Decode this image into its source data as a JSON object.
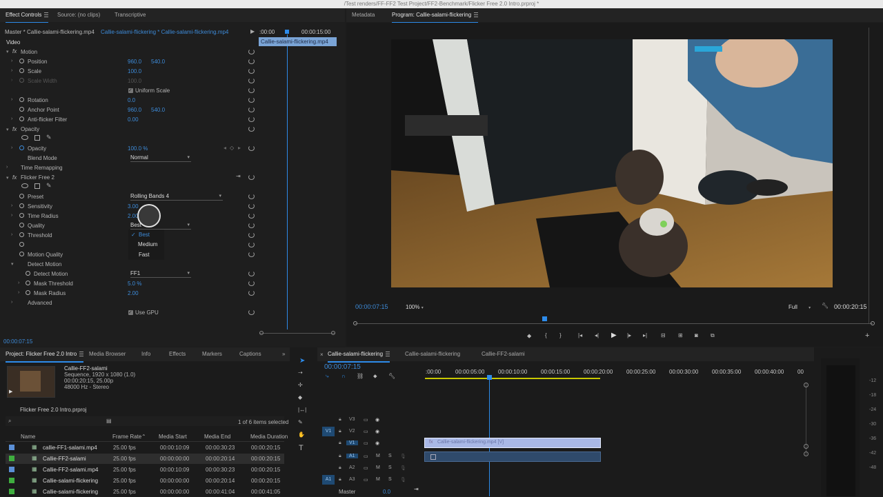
{
  "title_bar": "/Test renders/FF-FF2 Test Project/FF2-Benchmark/Flicker Free 2.0 Intro.prproj *",
  "top_tabs": {
    "effect_controls": "Effect Controls",
    "source": "Source: (no clips)",
    "transcriptive": "Transcriptive",
    "metadata": "Metadata",
    "program": "Program: Callie-salami-flickering"
  },
  "ec": {
    "master": "Master * Callie-salami-flickering.mp4",
    "clip": "Callie-salami-flickering * Callie-salami-flickering.mp4",
    "time_start": ":00:00",
    "time_end": "00:00:15:00",
    "clip_bar": "Callie-salami-flickering.mp4",
    "video_label": "Video",
    "current_time": "00:00:07:15",
    "motion": {
      "label": "Motion",
      "position": "Position",
      "pos_x": "960.0",
      "pos_y": "540.0",
      "scale": "Scale",
      "scale_val": "100.0",
      "scale_width": "Scale Width",
      "scale_width_val": "100.0",
      "uniform": "Uniform Scale",
      "rotation": "Rotation",
      "rotation_val": "0.0",
      "anchor": "Anchor Point",
      "anchor_x": "960.0",
      "anchor_y": "540.0",
      "antiflicker": "Anti-flicker Filter",
      "antiflicker_val": "0.00"
    },
    "opacity": {
      "label": "Opacity",
      "opacity": "Opacity",
      "opacity_val": "100.0 %",
      "blend": "Blend Mode",
      "blend_val": "Normal"
    },
    "time_remap": "Time Remapping",
    "ff": {
      "label": "Flicker Free 2",
      "preset": "Preset",
      "preset_val": "Rolling Bands 4",
      "sensitivity": "Sensitivity",
      "sensitivity_val": "3.00",
      "time_radius": "Time Radius",
      "time_radius_val": "2.00",
      "quality": "Quality",
      "quality_val": "Best",
      "threshold": "Threshold",
      "motion_quality": "Motion Quality",
      "detect_motion_group": "Detect Motion",
      "detect_motion": "Detect Motion",
      "detect_motion_val": "FF1",
      "mask_threshold": "Mask Threshold",
      "mask_threshold_val": "5.0 %",
      "mask_radius": "Mask Radius",
      "mask_radius_val": "2.00",
      "advanced": "Advanced",
      "use_gpu": "Use GPU"
    },
    "quality_menu": [
      "Best",
      "Medium",
      "Fast"
    ]
  },
  "program": {
    "timecode": "00:00:07:15",
    "zoom": "100%",
    "quality": "Full",
    "duration": "00:00:20:15"
  },
  "project": {
    "tabs": [
      "Project: Flicker Free 2.0 Intro",
      "Media Browser",
      "Info",
      "Effects",
      "Markers",
      "Captions"
    ],
    "item_name": "Callie-FF2-salami",
    "item_line1": "Sequence, 1920 x 1080 (1.0)",
    "item_line2": "00:00:20:15, 25.00p",
    "item_line3": "48000 Hz - Stereo",
    "project_file": "Flicker Free 2.0 Intro.prproj",
    "selected": "1 of 6 items selected",
    "columns": [
      "Name",
      "Frame Rate",
      "Media Start",
      "Media End",
      "Media Duration"
    ],
    "rows": [
      {
        "name": "callie-FF1-salami.mp4",
        "fps": "25.00 fps",
        "start": "00:00:10:09",
        "end": "00:00:30:23",
        "dur": "00:00:20:15",
        "color": "#5b8fd6"
      },
      {
        "name": "Callie-FF2-salami",
        "fps": "25.00 fps",
        "start": "00:00:00:00",
        "end": "00:00:20:14",
        "dur": "00:00:20:15",
        "color": "#3fae3f"
      },
      {
        "name": "Callie-FF2-salami.mp4",
        "fps": "25.00 fps",
        "start": "00:00:10:09",
        "end": "00:00:30:23",
        "dur": "00:00:20:15",
        "color": "#5b8fd6"
      },
      {
        "name": "Callie-salami-flickering",
        "fps": "25.00 fps",
        "start": "00:00:00:00",
        "end": "00:00:20:14",
        "dur": "00:00:20:15",
        "color": "#3fae3f"
      },
      {
        "name": "Callie-salami-flickering",
        "fps": "25.00 fps",
        "start": "00:00:00:00",
        "end": "00:00:41:04",
        "dur": "00:00:41:05",
        "color": "#3fae3f"
      }
    ]
  },
  "timeline": {
    "tabs": [
      "Callie-salami-flickering",
      "Callie-salami-flickering",
      "Callie-FF2-salami"
    ],
    "timecode": "00:00:07:15",
    "ruler": ":00:00",
    "r1": "00:00:05:00",
    "r2": "00:00:10:00",
    "r3": "00:00:15:00",
    "r4": "00:00:20:00",
    "r5": "00:00:25:00",
    "r6": "00:00:30:00",
    "r7": "00:00:35:00",
    "r8": "00:00:40:00",
    "r9": "00",
    "tracks": [
      "V3",
      "V2",
      "V1",
      "A1",
      "A2",
      "A3"
    ],
    "src_v": "V1",
    "src_a": "A1",
    "clip_label": "Callie-salami-flickering.mp4 [V]",
    "master": "Master",
    "master_val": "0.0"
  },
  "meter": [
    "-12",
    "-18",
    "-24",
    "-30",
    "-36",
    "-42",
    "-48"
  ]
}
